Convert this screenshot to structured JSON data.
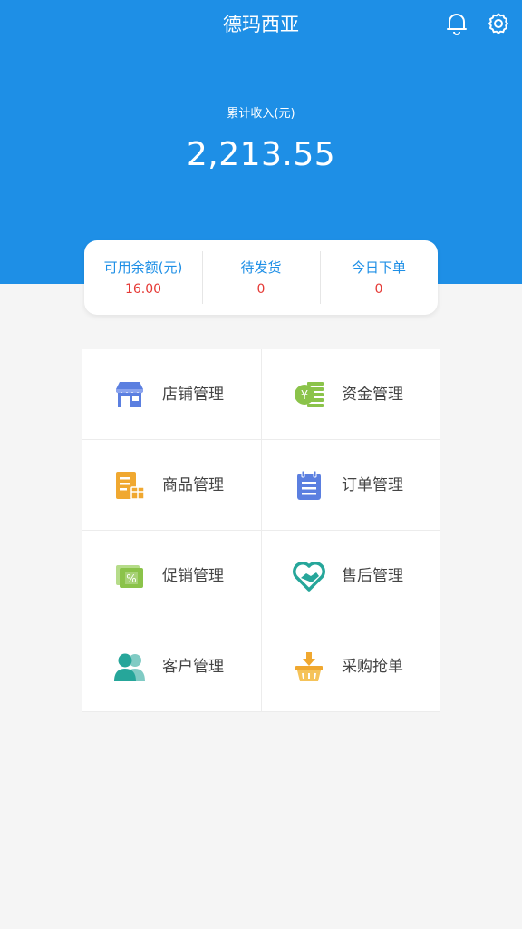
{
  "header": {
    "title": "德玛西亚",
    "bell_icon": "bell-icon",
    "settings_icon": "gear-icon",
    "background_color": "#1e8fe6"
  },
  "income": {
    "label": "累计收入(元)",
    "value": "2,213.55"
  },
  "summary": [
    {
      "label": "可用余额(元)",
      "value": "16.00"
    },
    {
      "label": "待发货",
      "value": "0"
    },
    {
      "label": "今日下单",
      "value": "0"
    }
  ],
  "menu": [
    {
      "label": "店铺管理",
      "icon": "store-icon",
      "color": "#5b7fe0"
    },
    {
      "label": "资金管理",
      "icon": "money-icon",
      "color": "#8bc34a"
    },
    {
      "label": "商品管理",
      "icon": "goods-icon",
      "color": "#f0a830"
    },
    {
      "label": "订单管理",
      "icon": "order-icon",
      "color": "#5b7fe0"
    },
    {
      "label": "促销管理",
      "icon": "promotion-icon",
      "color": "#8bc34a"
    },
    {
      "label": "售后管理",
      "icon": "after-sales-icon",
      "color": "#26a69a"
    },
    {
      "label": "客户管理",
      "icon": "customer-icon",
      "color": "#26a69a"
    },
    {
      "label": "采购抢单",
      "icon": "purchase-basket-icon",
      "color": "#f0a830"
    }
  ]
}
